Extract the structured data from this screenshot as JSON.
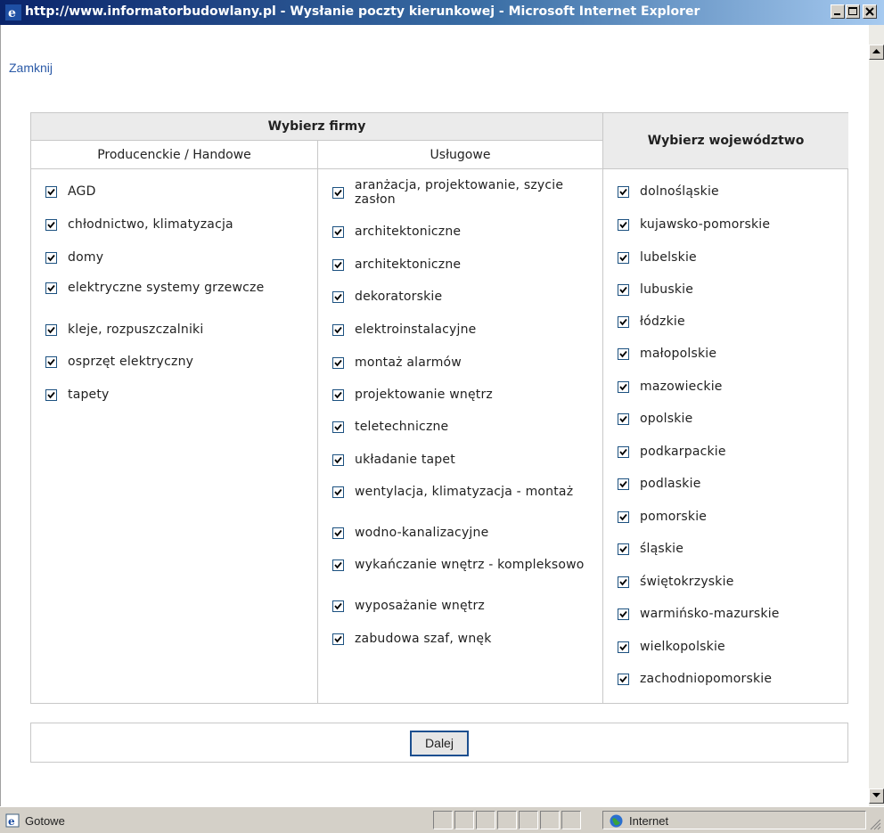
{
  "window": {
    "title": "http://www.informatorbudowlany.pl - Wysłanie poczty kierunkowej - Microsoft Internet Explorer",
    "controls": [
      "minimize-icon",
      "maximize-icon",
      "close-icon"
    ]
  },
  "page": {
    "close_link": "Zamknij",
    "firms_header": "Wybierz firmy",
    "voivodeship_header": "Wybierz województwo",
    "col1_header": "Producenckie / Handowe",
    "col2_header": "Usługowe",
    "col1_items": [
      {
        "label": "AGD",
        "checked": true
      },
      {
        "label": "chłodnictwo, klimatyzacja",
        "checked": true
      },
      {
        "label": "domy",
        "checked": true
      },
      {
        "label": "elektryczne systemy grzewcze",
        "checked": true
      },
      {
        "label": "kleje, rozpuszczalniki",
        "checked": true
      },
      {
        "label": "osprzęt elektryczny",
        "checked": true
      },
      {
        "label": "tapety",
        "checked": true
      }
    ],
    "col2_items": [
      {
        "label": "aranżacja, projektowanie, szycie zasłon",
        "checked": true
      },
      {
        "label": "architektoniczne",
        "checked": true
      },
      {
        "label": "architektoniczne",
        "checked": true
      },
      {
        "label": "dekoratorskie",
        "checked": true
      },
      {
        "label": "elektroinstalacyjne",
        "checked": true
      },
      {
        "label": "montaż alarmów",
        "checked": true
      },
      {
        "label": "projektowanie wnętrz",
        "checked": true
      },
      {
        "label": "teletechniczne",
        "checked": true
      },
      {
        "label": "układanie tapet",
        "checked": true
      },
      {
        "label": "wentylacja, klimatyzacja - montaż",
        "checked": true
      },
      {
        "label": "wodno-kanalizacyjne",
        "checked": true
      },
      {
        "label": "wykańczanie wnętrz - kompleksowo",
        "checked": true
      },
      {
        "label": "wyposażanie wnętrz",
        "checked": true
      },
      {
        "label": "zabudowa szaf, wnęk",
        "checked": true
      }
    ],
    "col3_items": [
      {
        "label": "dolnośląskie",
        "checked": true
      },
      {
        "label": "kujawsko-pomorskie",
        "checked": true
      },
      {
        "label": "lubelskie",
        "checked": true
      },
      {
        "label": "lubuskie",
        "checked": true
      },
      {
        "label": "łódzkie",
        "checked": true
      },
      {
        "label": "małopolskie",
        "checked": true
      },
      {
        "label": "mazowieckie",
        "checked": true
      },
      {
        "label": "opolskie",
        "checked": true
      },
      {
        "label": "podkarpackie",
        "checked": true
      },
      {
        "label": "podlaskie",
        "checked": true
      },
      {
        "label": "pomorskie",
        "checked": true
      },
      {
        "label": "śląskie",
        "checked": true
      },
      {
        "label": "świętokrzyskie",
        "checked": true
      },
      {
        "label": "warmińsko-mazurskie",
        "checked": true
      },
      {
        "label": "wielkopolskie",
        "checked": true
      },
      {
        "label": "zachodniopomorskie",
        "checked": true
      }
    ],
    "next_button": "Dalej"
  },
  "statusbar": {
    "status": "Gotowe",
    "zone": "Internet"
  },
  "colors": {
    "link": "#2b5aa7",
    "header_bg": "#ebebeb",
    "checkbox_border": "#1c5180"
  }
}
